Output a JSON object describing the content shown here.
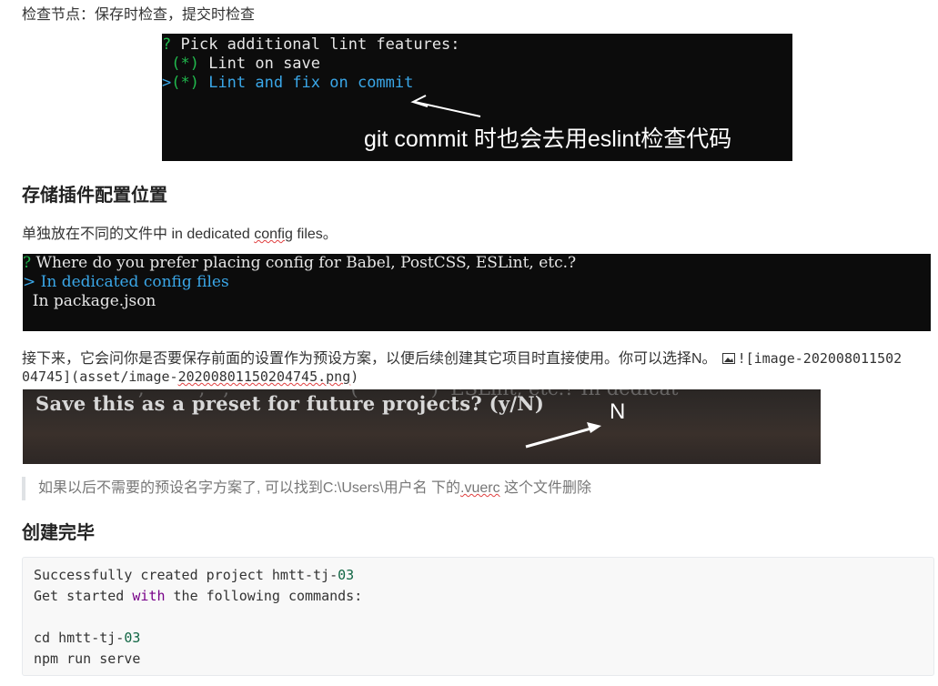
{
  "section_checkpoint": {
    "text": "检查节点：保存时检查，提交时检查"
  },
  "terminal_lint": {
    "prompt_mark": "?",
    "question": " Pick additional lint features:",
    "option1_mark": " (*)",
    "option1_label": " Lint on save",
    "cursor": ">",
    "option2_mark": "(*)",
    "option2_label": " Lint and fix on commit",
    "annotation": "git commit 时也会去用eslint检查代码"
  },
  "heading_storage": "存储插件配置位置",
  "storage_desc": {
    "prefix": "单独放在不同的文件中 in dedicated ",
    "underlined": "config",
    "suffix": " files。"
  },
  "terminal_config": {
    "prompt_mark": "?",
    "question": " Where do you prefer placing config for Babel, PostCSS, ESLint, etc.?",
    "cursor": ">",
    "selected": " In dedicated config files",
    "other": "  In package.json"
  },
  "preset_desc": {
    "line1": "接下来，它会问你是否要保存前面的设置作为预设方案，以便后续创建其它项目时直接使用。你可以选择N。",
    "image_md_line1": "![image-202008011502",
    "image_md_line2_a": "04745](asset/image-",
    "image_md_line2_underlined": "20200801150204745.png",
    "image_md_line2_b": ")"
  },
  "terminal_preset_photo": {
    "ghost_text": "                   ,         ,   ,                    (            )  ESLint, etc.? In dedicat",
    "question": "Save this as a preset for future projects? (y/N)",
    "annotation": "N"
  },
  "quote_note": {
    "prefix": "如果以后不需要的预设名字方案了, 可以找到C:\\Users\\用户名 下的",
    "underlined": ".vuerc",
    "suffix": " 这个文件删除"
  },
  "heading_done": "创建完毕",
  "code_block": {
    "line1_a": "Successfully created project hmtt-tj-",
    "line1_num": "03",
    "line2_a": "Get started ",
    "line2_kw": "with",
    "line2_b": " the following commands:",
    "line4_a": "cd hmtt-tj-",
    "line4_num": "03",
    "line5": "npm run serve"
  },
  "colors": {
    "terminal_bg": "#0c0c0c",
    "terminal_green": "#21b94d",
    "terminal_cyan": "#3aa7e8",
    "code_number": "#116644",
    "code_keyword": "#770088"
  }
}
